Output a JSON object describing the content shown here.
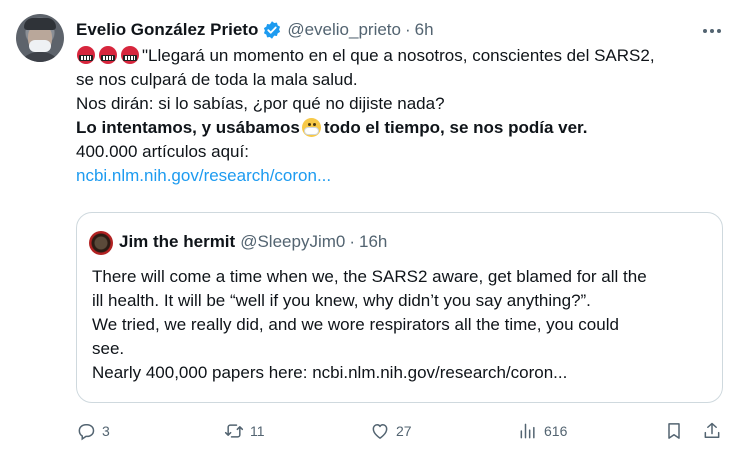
{
  "author": {
    "name": "Evelio González Prieto",
    "handle": "@evelio_prieto",
    "separator": "·",
    "time": "6h"
  },
  "tweet": {
    "line1": "\"Llegará un momento en el que a nosotros, conscientes del SARS2,",
    "line2": "se nos culpará de toda la mala salud.",
    "line3": "Nos dirán: si lo sabías, ¿por qué no dijiste nada?",
    "line4_before": "Lo intentamos, y usábamos",
    "line4_after": "todo el tiempo, se nos podía ver.",
    "line5": "400.000 artículos aquí:",
    "link": "ncbi.nlm.nih.gov/research/coron..."
  },
  "quote": {
    "name": "Jim the hermit",
    "handle": "@SleepyJim0",
    "separator": "·",
    "time": "16h",
    "lines": [
      "There will come a time when we, the SARS2 aware, get blamed for all the",
      "ill health. It will be “well if you knew, why didn’t you say anything?”.",
      "We tried, we really did, and we wore respirators all the time, you could",
      "see.",
      "Nearly 400,000 papers here: ncbi.nlm.nih.gov/research/coron..."
    ]
  },
  "actions": {
    "replies": "3",
    "retweets": "11",
    "likes": "27",
    "views": "616"
  },
  "colors": {
    "accent": "#1d9bf0",
    "text": "#0f1419",
    "muted": "#536471",
    "border": "#cfd9de"
  },
  "icons": [
    "verified-badge-icon",
    "more-icon",
    "angry-face-icon",
    "face-with-mask-icon",
    "reply-icon",
    "retweet-icon",
    "like-icon",
    "views-icon",
    "bookmark-icon",
    "share-icon"
  ]
}
